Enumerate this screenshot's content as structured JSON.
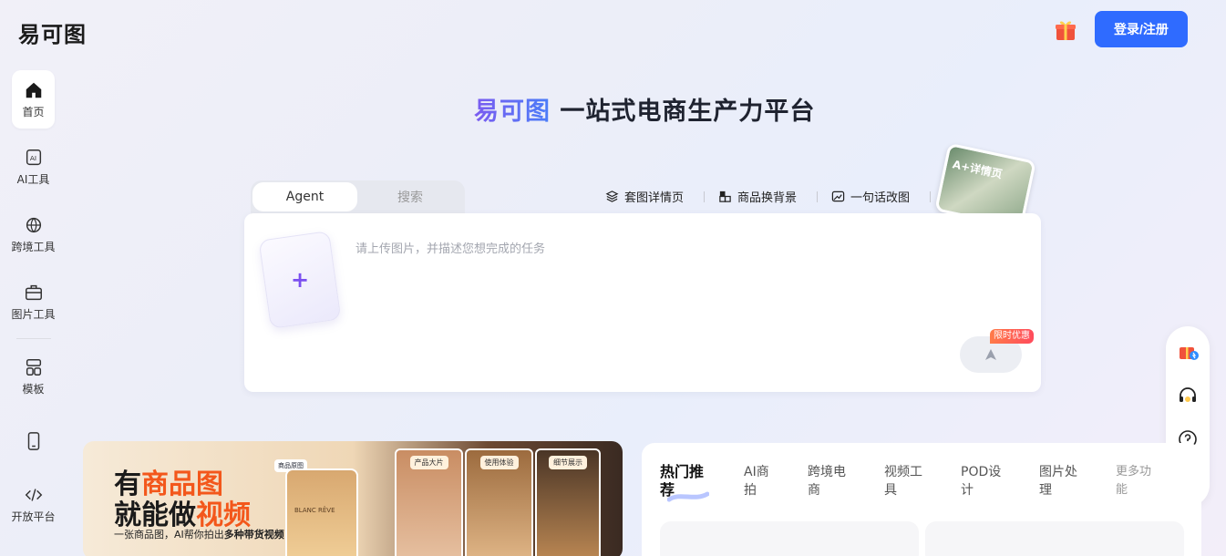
{
  "header": {
    "logo": "易可图",
    "login_label": "登录/注册"
  },
  "sidebar": {
    "items": [
      {
        "label": "首页",
        "icon": "home-icon"
      },
      {
        "label": "AI工具",
        "icon": "ai-icon"
      },
      {
        "label": "跨境工具",
        "icon": "globe-icon"
      },
      {
        "label": "图片工具",
        "icon": "toolbox-icon"
      },
      {
        "label": "模板",
        "icon": "template-icon"
      },
      {
        "label": "",
        "icon": "mobile-icon"
      },
      {
        "label": "开放平台",
        "icon": "code-icon"
      }
    ]
  },
  "hero": {
    "brand": "易可图",
    "slogan": "一站式电商生产力平台"
  },
  "tabs": {
    "agent": "Agent",
    "search": "搜索"
  },
  "quick_actions": [
    {
      "label": "套图详情页",
      "icon": "layers-icon"
    },
    {
      "label": "商品换背景",
      "icon": "swap-bg-icon"
    },
    {
      "label": "一句话改图",
      "icon": "edit-image-icon"
    }
  ],
  "deco_card": {
    "label": "A+详情页"
  },
  "composer": {
    "placeholder": "请上传图片，并描述您想完成的任务",
    "upload_symbol": "+",
    "badge": "限时优惠"
  },
  "floatbar": {
    "icons": [
      "gift-icon",
      "headset-icon",
      "help-icon",
      "apps-icon"
    ]
  },
  "banner": {
    "line1_a": "有",
    "line1_b": "商品图",
    "line2_a": "就能做",
    "line2_b": "视频",
    "line3_a": "一张商品图，AI帮你拍出",
    "line3_b": "多种带货视频",
    "product_label": "商品原图",
    "bottle_text": "BLANC RÊVE",
    "photos": [
      "产品大片",
      "使用体验",
      "细节展示"
    ]
  },
  "hot": {
    "tabs": [
      "热门推荐",
      "AI商拍",
      "跨境电商",
      "视频工具",
      "POD设计",
      "图片处理",
      "更多功能"
    ]
  }
}
